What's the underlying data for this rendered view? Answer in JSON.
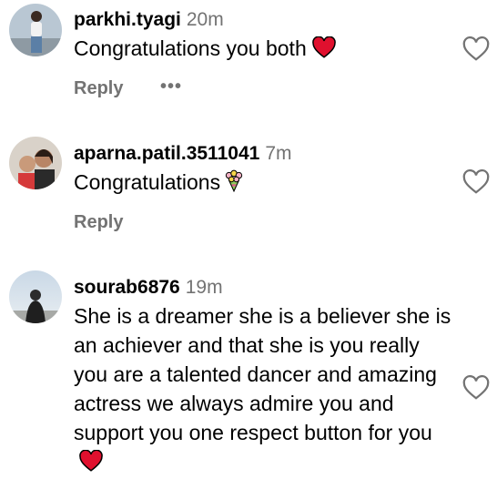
{
  "comments": [
    {
      "username": "parkhi.tyagi",
      "time": "20m",
      "text": "Congratulations you both",
      "emoji": "red-heart",
      "reply_label": "Reply",
      "more_label": "•••",
      "like_icon": "heart-outline-icon"
    },
    {
      "username": "aparna.patil.3511041",
      "time": "7m",
      "text": "Congratulations",
      "emoji": "bouquet",
      "reply_label": "Reply",
      "like_icon": "heart-outline-icon"
    },
    {
      "username": "sourab6876",
      "time": "19m",
      "text": "She is a dreamer she is a believer she is an achiever and that she is you really you are a talented dancer and amazing actress we always admire you and support you one respect button for you",
      "emoji": "red-heart",
      "like_icon": "heart-outline-icon"
    }
  ],
  "colors": {
    "muted": "#737373",
    "heart": "#e0102e"
  }
}
